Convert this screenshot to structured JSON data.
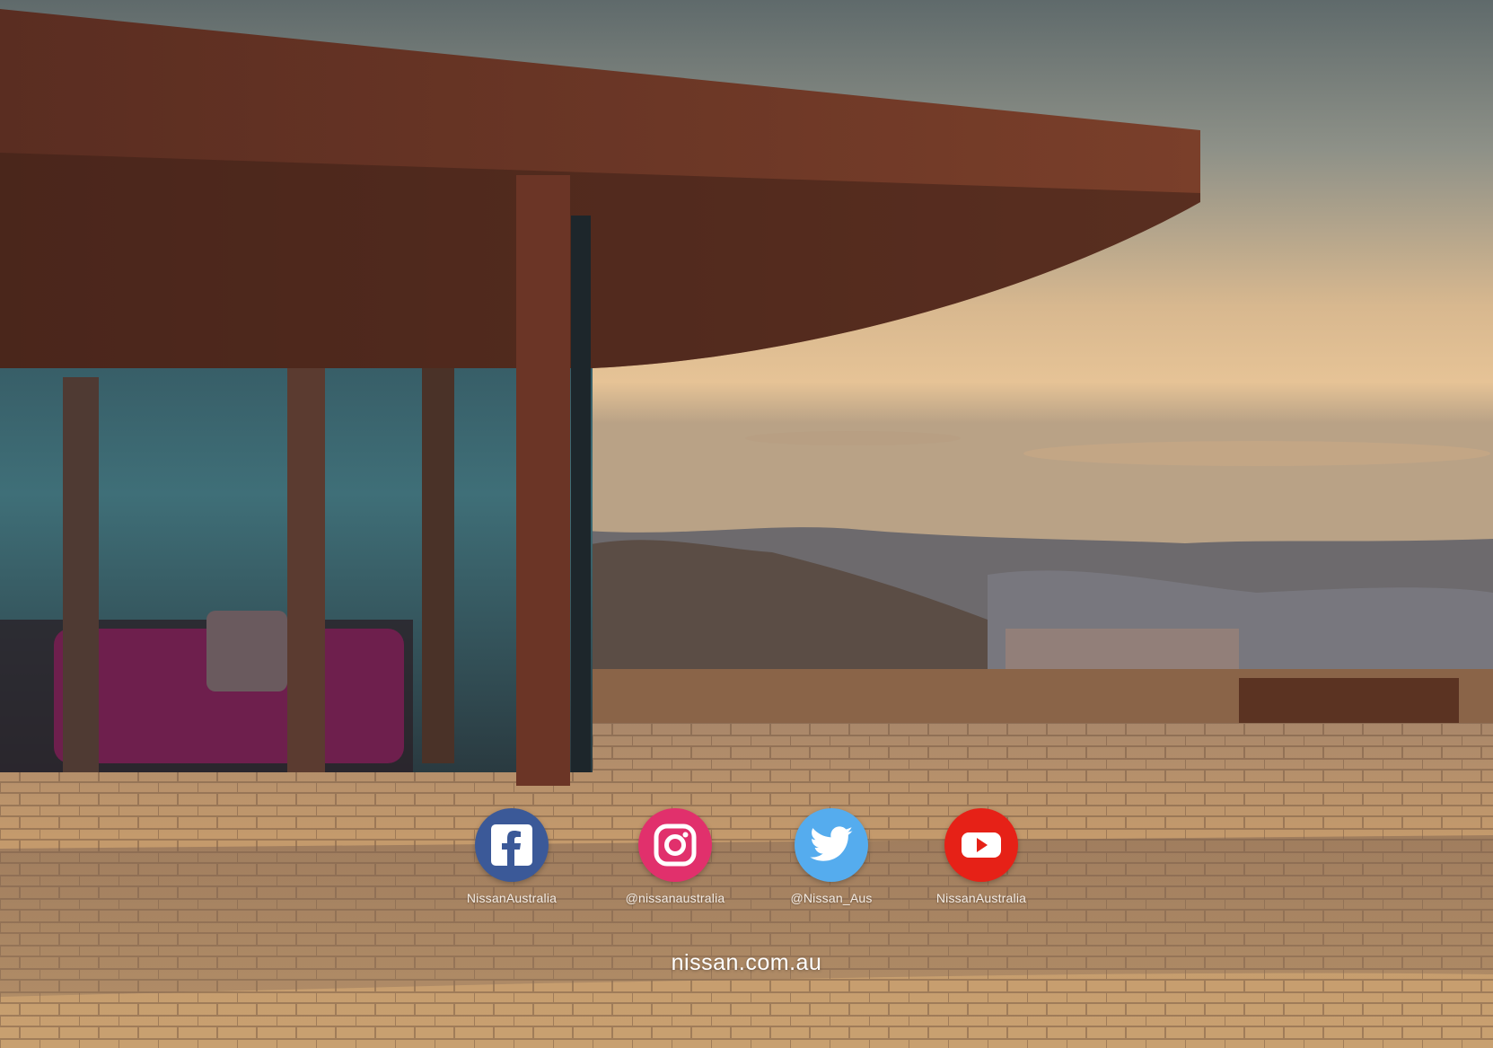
{
  "social": [
    {
      "id": "facebook",
      "icon": "facebook-icon",
      "color": "#3b5998",
      "handle": "NissanAustralia"
    },
    {
      "id": "instagram",
      "icon": "instagram-icon",
      "color": "#e1306c",
      "handle": "@nissanaustralia"
    },
    {
      "id": "twitter",
      "icon": "twitter-icon",
      "color": "#55acee",
      "handle": "@Nissan_Aus"
    },
    {
      "id": "youtube",
      "icon": "youtube-icon",
      "color": "#e62117",
      "handle": "NissanAustralia"
    }
  ],
  "website": {
    "url": "nissan.com.au"
  }
}
